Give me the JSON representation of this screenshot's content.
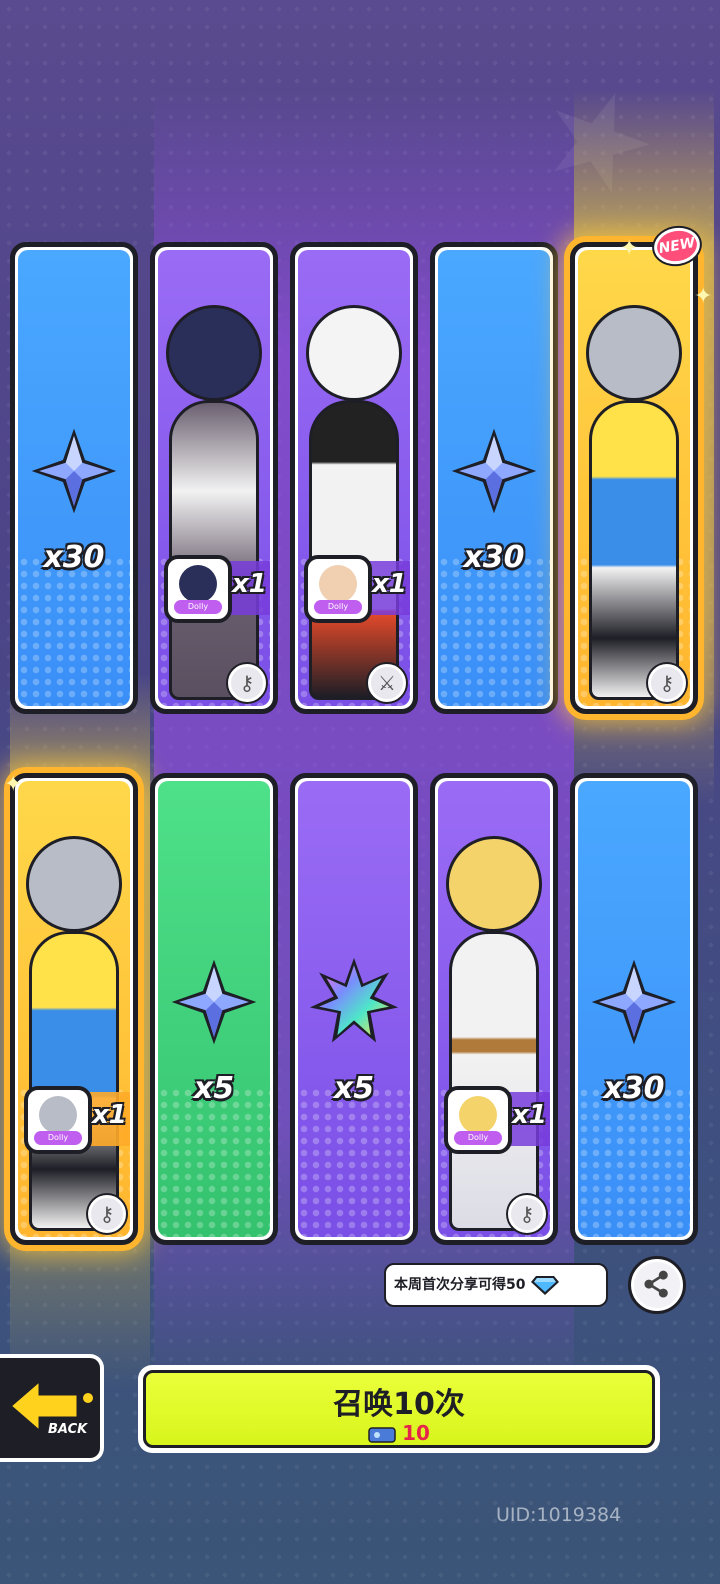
{
  "cards_top": [
    {
      "type": "item",
      "qty": "x30",
      "bg": "#4aa8ff",
      "icon": "blue-star-crystal-icon"
    },
    {
      "type": "character",
      "qty": "x1",
      "bg": "#8a5df0",
      "tag": "Dolly",
      "role_icon": "key-icon"
    },
    {
      "type": "character",
      "qty": "x1",
      "bg": "#8a5df0",
      "tag": "Dolly",
      "role_icon": "sword-icon"
    },
    {
      "type": "item",
      "qty": "x30",
      "bg": "#4aa8ff",
      "icon": "blue-star-crystal-icon"
    },
    {
      "type": "character",
      "qty": "",
      "bg": "#ffc83a",
      "tag": "",
      "role_icon": "key-icon",
      "new_label": "NEW"
    }
  ],
  "cards_bottom": [
    {
      "type": "character",
      "qty": "x1",
      "bg": "#ffc83a",
      "tag": "Dolly",
      "role_icon": "key-icon"
    },
    {
      "type": "item",
      "qty": "x5",
      "bg": "#4fe08a",
      "icon": "blue-star-crystal-icon"
    },
    {
      "type": "item",
      "qty": "x5",
      "bg": "#9a6cf5",
      "icon": "rainbow-star-crystal-icon"
    },
    {
      "type": "character",
      "qty": "x1",
      "bg": "#8a5df0",
      "tag": "Dolly",
      "role_icon": "key-icon"
    },
    {
      "type": "item",
      "qty": "x30",
      "bg": "#4aa8ff",
      "icon": "blue-star-crystal-icon"
    }
  ],
  "share": {
    "tip": "本周首次分享可得50"
  },
  "back": {
    "label": "BACK"
  },
  "summon": {
    "label": "召唤10次",
    "cost": "10"
  },
  "uid": "UID:1019384"
}
